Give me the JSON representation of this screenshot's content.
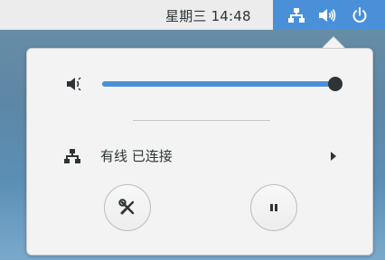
{
  "topbar": {
    "clock": "星期三 14:48",
    "tray": {
      "icons": [
        "network-wired-icon",
        "volume-icon",
        "power-icon"
      ],
      "background": "#4a90d9"
    }
  },
  "popover": {
    "volume": {
      "icon": "volume-low-icon",
      "level": 1.0,
      "accent": "#4a90d9"
    },
    "network": {
      "icon": "network-wired-icon",
      "label": "有线 已连接"
    },
    "buttons": [
      {
        "name": "settings-button",
        "icon": "tools-icon"
      },
      {
        "name": "pause-button",
        "icon": "pause-icon"
      }
    ]
  }
}
